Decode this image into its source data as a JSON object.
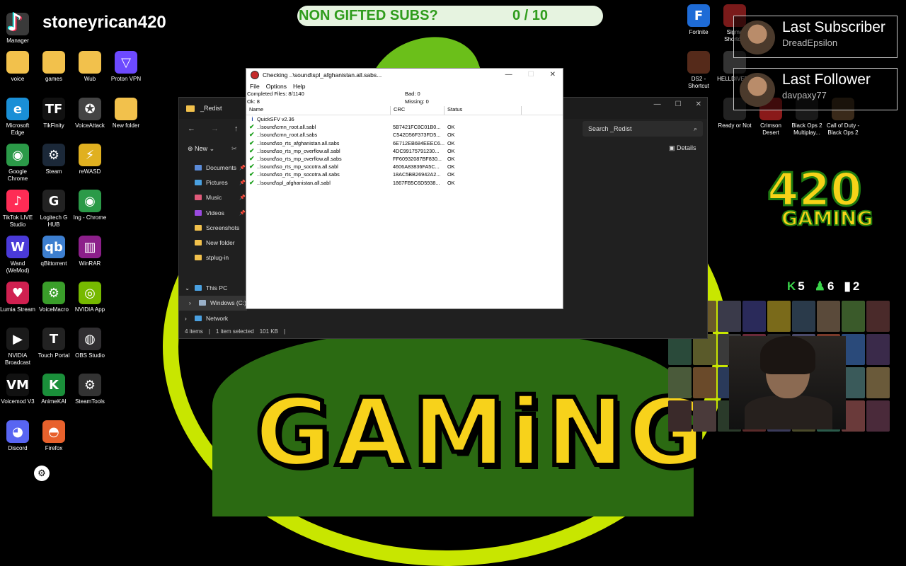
{
  "overlay": {
    "streamer_name": "stoneyrican420",
    "goal_label": "NON GIFTED SUBS?",
    "goal_progress": "0 / 10",
    "last_subscriber_title": "Last Subscriber",
    "last_subscriber_name": "DreadEpsilon",
    "last_follower_title": "Last Follower",
    "last_follower_name": "davpaxy77",
    "logo_number": "420",
    "logo_word": "GAMING",
    "stat_kills": "5",
    "stat_players": "6",
    "stat_bars": "2",
    "wallpaper_word": "GAMiNG"
  },
  "desktop_left": [
    {
      "label": "Manager",
      "icon": "app-icon",
      "color": "#3a3a3a",
      "glyph": ""
    },
    {
      "label": "voice",
      "icon": "folder-icon",
      "color": "#f2c14c",
      "glyph": ""
    },
    {
      "label": "games",
      "icon": "folder-icon",
      "color": "#f2c14c",
      "glyph": ""
    },
    {
      "label": "Wub",
      "icon": "folder-icon",
      "color": "#f2c14c",
      "glyph": ""
    },
    {
      "label": "Proton VPN",
      "icon": "proton-vpn-icon",
      "color": "#6d4aff",
      "glyph": "▽"
    },
    {
      "label": "Microsoft Edge",
      "icon": "edge-icon",
      "color": "#1a8fd6",
      "glyph": "e"
    },
    {
      "label": "TikFinity",
      "icon": "tikfinity-icon",
      "color": "#111111",
      "glyph": "TF"
    },
    {
      "label": "VoiceAttack",
      "icon": "voiceattack-icon",
      "color": "#444444",
      "glyph": "✪"
    },
    {
      "label": "New folder",
      "icon": "folder-icon",
      "color": "#f2c14c",
      "glyph": ""
    },
    {
      "label": "Google Chrome",
      "icon": "chrome-icon",
      "color": "#2b9a48",
      "glyph": "◉"
    },
    {
      "label": "Steam",
      "icon": "steam-icon",
      "color": "#1b2838",
      "glyph": "⚙"
    },
    {
      "label": "reWASD",
      "icon": "rewasd-icon",
      "color": "#e0b020",
      "glyph": "⚡"
    },
    {
      "label": "TikTok LIVE Studio",
      "icon": "tiktok-live-icon",
      "color": "#fe2c55",
      "glyph": "♪"
    },
    {
      "label": "Logitech G HUB",
      "icon": "logitech-icon",
      "color": "#222222",
      "glyph": "G"
    },
    {
      "label": "Ing - Chrome",
      "icon": "chrome-icon",
      "color": "#2b9a48",
      "glyph": "◉"
    },
    {
      "label": "Wand (WeMod)",
      "icon": "wemod-icon",
      "color": "#4a3ad8",
      "glyph": "W"
    },
    {
      "label": "qBittorrent",
      "icon": "qbittorrent-icon",
      "color": "#3d7fd0",
      "glyph": "qb"
    },
    {
      "label": "WinRAR",
      "icon": "winrar-icon",
      "color": "#8c1f8a",
      "glyph": "▥"
    },
    {
      "label": "Lumia Stream",
      "icon": "lumia-icon",
      "color": "#d02050",
      "glyph": "♥"
    },
    {
      "label": "VoiceMacro",
      "icon": "voicemacro-icon",
      "color": "#3a9e2a",
      "glyph": "⚙"
    },
    {
      "label": "NVIDIA App",
      "icon": "nvidia-icon",
      "color": "#76b900",
      "glyph": "◎"
    },
    {
      "label": "NVIDIA Broadcast",
      "icon": "nvidia-broadcast-icon",
      "color": "#1a1a1a",
      "glyph": "▶"
    },
    {
      "label": "Touch Portal",
      "icon": "touch-portal-icon",
      "color": "#222222",
      "glyph": "T"
    },
    {
      "label": "OBS Studio",
      "icon": "obs-icon",
      "color": "#302e31",
      "glyph": "◍"
    },
    {
      "label": "Voicemod V3",
      "icon": "voicemod-icon",
      "color": "#111111",
      "glyph": "VM"
    },
    {
      "label": "AnimeKAI",
      "icon": "animekai-icon",
      "color": "#1a8f3a",
      "glyph": "K"
    },
    {
      "label": "SteamTools",
      "icon": "steamtools-icon",
      "color": "#333333",
      "glyph": "⚙"
    },
    {
      "label": "Discord",
      "icon": "discord-icon",
      "color": "#5865f2",
      "glyph": "◕"
    },
    {
      "label": "Firefox",
      "icon": "firefox-icon",
      "color": "#e8612c",
      "glyph": "◓"
    }
  ],
  "desktop_right": [
    {
      "label": "Fortnite",
      "icon": "fortnite-icon",
      "color": "#1e6bd6",
      "glyph": "F"
    },
    {
      "label": "Sigma Shortcut",
      "icon": "game-icon",
      "color": "#7a1a1a",
      "glyph": ""
    },
    {
      "label": "DS2 - Shortcut",
      "icon": "game-icon",
      "color": "#552a1a",
      "glyph": ""
    },
    {
      "label": "HELLDIVERS",
      "icon": "game-icon",
      "color": "#333333",
      "glyph": ""
    },
    {
      "label": "Ready or Not",
      "icon": "game-icon",
      "color": "#222222",
      "glyph": ""
    },
    {
      "label": "Crimson Desert",
      "icon": "game-icon",
      "color": "#8a1a1a",
      "glyph": ""
    },
    {
      "label": "Black Ops 2 Multiplay...",
      "icon": "game-icon",
      "color": "#1a1a1a",
      "glyph": ""
    },
    {
      "label": "Call of Duty - Black Ops 2",
      "icon": "game-icon",
      "color": "#3a2a1a",
      "glyph": ""
    }
  ],
  "explorer": {
    "title": "_Redist",
    "search_placeholder": "Search _Redist",
    "new_label": "New",
    "details_label": "Details",
    "nav": [
      {
        "label": "Documents",
        "icon": "documents-icon",
        "color": "#5b8bd8",
        "pinned": true
      },
      {
        "label": "Pictures",
        "icon": "pictures-icon",
        "color": "#4aa0e0",
        "pinned": true
      },
      {
        "label": "Music",
        "icon": "music-icon",
        "color": "#e05a7a",
        "pinned": true
      },
      {
        "label": "Videos",
        "icon": "videos-icon",
        "color": "#9a4ae0",
        "pinned": true
      },
      {
        "label": "Screenshots",
        "icon": "folder-icon",
        "color": "#f2c14c",
        "pinned": false
      },
      {
        "label": "New folder",
        "icon": "folder-icon",
        "color": "#f2c14c",
        "pinned": false
      },
      {
        "label": "stplug-in",
        "icon": "folder-icon",
        "color": "#f2c14c",
        "pinned": false
      },
      {
        "label": "",
        "icon": "",
        "color": "",
        "pinned": false
      },
      {
        "label": "This PC",
        "icon": "this-pc-icon",
        "color": "#4aa0e0",
        "pinned": false
      },
      {
        "label": "Windows (C:)",
        "icon": "drive-icon",
        "color": "#9ab0c8",
        "pinned": false
      },
      {
        "label": "Network",
        "icon": "network-icon",
        "color": "#4aa0e0",
        "pinned": false
      }
    ],
    "status_items": "4 items",
    "status_selected": "1 item selected",
    "status_size": "101 KB"
  },
  "quicksfv": {
    "window_title": "Checking ..\\sound\\spl_afghanistan.all.sabs...",
    "menu": [
      "File",
      "Options",
      "Help"
    ],
    "completed": "Completed Files: 8/1140",
    "ok": "Ok: 8",
    "bad": "Bad: 0",
    "missing": "Missing: 0",
    "columns": [
      "Name",
      "CRC",
      "Status"
    ],
    "version_row": "QuickSFV v2.36",
    "rows": [
      {
        "name": "..\\sound\\cmn_root.all.sabl",
        "crc": "5B7421FC8C01B0...",
        "status": "OK"
      },
      {
        "name": "..\\sound\\cmn_root.all.sabs",
        "crc": "C542D56F373FD5...",
        "status": "OK"
      },
      {
        "name": "..\\sound\\so_rts_afghanistan.all.sabs",
        "crc": "6E712EB684EEEC6...",
        "status": "OK"
      },
      {
        "name": "..\\sound\\so_rts_mp_overflow.all.sabl",
        "crc": "4DC99175791230...",
        "status": "OK"
      },
      {
        "name": "..\\sound\\so_rts_mp_overflow.all.sabs",
        "crc": "FF60932087BF830...",
        "status": "OK"
      },
      {
        "name": "..\\sound\\so_rts_mp_socotra.all.sabl",
        "crc": "4606A83836FA5C...",
        "status": "OK"
      },
      {
        "name": "..\\sound\\so_rts_mp_socotra.all.sabs",
        "crc": "18AC5BB26942A2...",
        "status": "OK"
      },
      {
        "name": "..\\sound\\spl_afghanistan.all.sabl",
        "crc": "1867FB5C6D5938...",
        "status": "OK"
      }
    ]
  }
}
